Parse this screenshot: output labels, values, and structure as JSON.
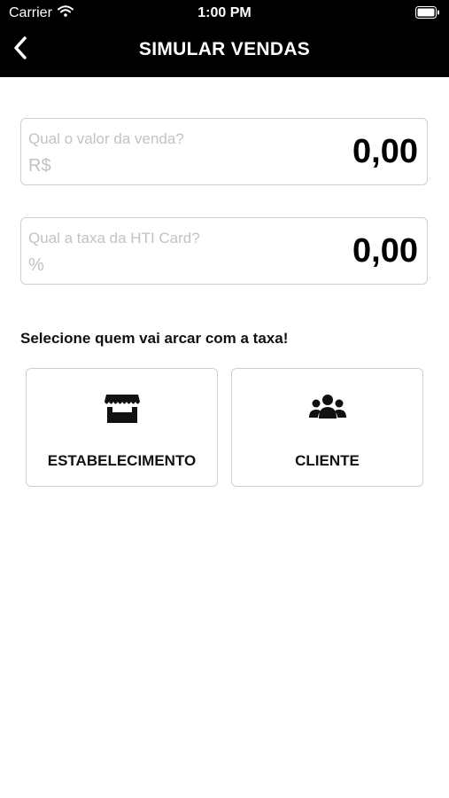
{
  "status_bar": {
    "carrier": "Carrier",
    "time": "1:00 PM"
  },
  "nav": {
    "title": "SIMULAR VENDAS",
    "back_icon": "chevron-left-icon"
  },
  "sale_field": {
    "label": "Qual o valor da venda?",
    "unit": "R$",
    "value": "0,00"
  },
  "rate_field": {
    "label": "Qual a taxa da HTI Card?",
    "unit": "%",
    "value": "0,00"
  },
  "prompt": "Selecione quem vai arcar com a taxa!",
  "options": [
    {
      "label": "ESTABELECIMENTO",
      "icon": "store-icon"
    },
    {
      "label": "CLIENTE",
      "icon": "users-icon"
    }
  ]
}
